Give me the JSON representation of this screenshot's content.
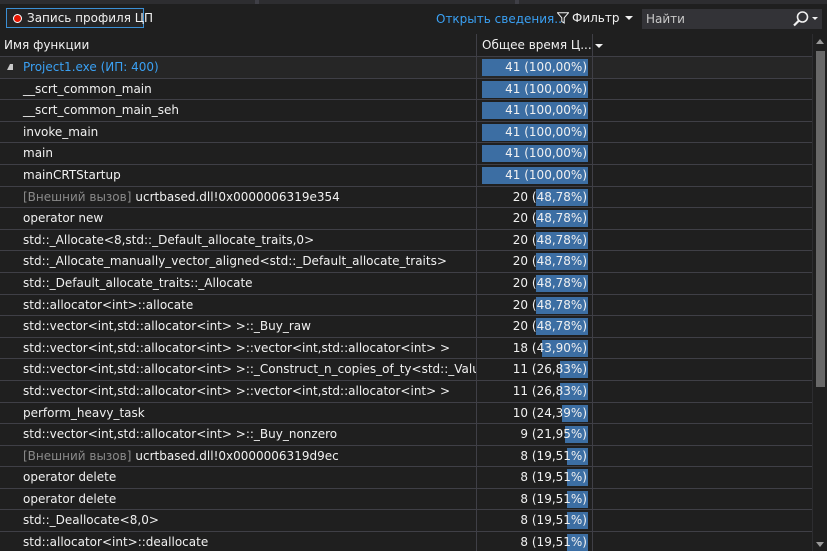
{
  "toolbar": {
    "record_label": "Запись профиля ЦП",
    "open_details_label": "Открыть сведения...",
    "filter_label": "Фильтр",
    "search_placeholder": "Найти"
  },
  "columns": {
    "name": "Имя функции",
    "total_time": "Общее время Ц..."
  },
  "colors": {
    "accent_link": "#3aa0f3",
    "bar": "#3c6ea3",
    "record_dot": "#e51400",
    "background": "#1f1f1f"
  },
  "rows": [
    {
      "name": "Project1.exe (ИП: 400)",
      "prefix": "",
      "time": "41 (100,00%)",
      "percent": 100.0,
      "root": true
    },
    {
      "name": "__scrt_common_main",
      "prefix": "",
      "time": "41 (100,00%)",
      "percent": 100.0
    },
    {
      "name": "__scrt_common_main_seh",
      "prefix": "",
      "time": "41 (100,00%)",
      "percent": 100.0
    },
    {
      "name": "invoke_main",
      "prefix": "",
      "time": "41 (100,00%)",
      "percent": 100.0
    },
    {
      "name": "main",
      "prefix": "",
      "time": "41 (100,00%)",
      "percent": 100.0
    },
    {
      "name": "mainCRTStartup",
      "prefix": "",
      "time": "41 (100,00%)",
      "percent": 100.0
    },
    {
      "name": "ucrtbased.dll!0x0000006319e354",
      "prefix": "[Внешний вызов]",
      "time": "20 (48,78%)",
      "percent": 48.78
    },
    {
      "name": "operator new",
      "prefix": "",
      "time": "20 (48,78%)",
      "percent": 48.78
    },
    {
      "name": "std::_Allocate<8,std::_Default_allocate_traits,0>",
      "prefix": "",
      "time": "20 (48,78%)",
      "percent": 48.78
    },
    {
      "name": "std::_Allocate_manually_vector_aligned<std::_Default_allocate_traits>",
      "prefix": "",
      "time": "20 (48,78%)",
      "percent": 48.78
    },
    {
      "name": "std::_Default_allocate_traits::_Allocate",
      "prefix": "",
      "time": "20 (48,78%)",
      "percent": 48.78
    },
    {
      "name": "std::allocator<int>::allocate",
      "prefix": "",
      "time": "20 (48,78%)",
      "percent": 48.78
    },
    {
      "name": "std::vector<int,std::allocator<int> >::_Buy_raw",
      "prefix": "",
      "time": "20 (48,78%)",
      "percent": 48.78
    },
    {
      "name": "std::vector<int,std::allocator<int> >::vector<int,std::allocator<int> >",
      "prefix": "",
      "time": "18 (43,90%)",
      "percent": 43.9
    },
    {
      "name": "std::vector<int,std::allocator<int> >::_Construct_n_copies_of_ty<std::_Value_init_tag>",
      "prefix": "",
      "time": "11 (26,83%)",
      "percent": 26.83
    },
    {
      "name": "std::vector<int,std::allocator<int> >::vector<int,std::allocator<int> >",
      "prefix": "",
      "time": "11 (26,83%)",
      "percent": 26.83
    },
    {
      "name": "perform_heavy_task",
      "prefix": "",
      "time": "10 (24,39%)",
      "percent": 24.39
    },
    {
      "name": "std::vector<int,std::allocator<int> >::_Buy_nonzero",
      "prefix": "",
      "time": "9 (21,95%)",
      "percent": 21.95
    },
    {
      "name": "ucrtbased.dll!0x0000006319d9ec",
      "prefix": "[Внешний вызов]",
      "time": "8 (19,51%)",
      "percent": 19.51
    },
    {
      "name": "operator delete",
      "prefix": "",
      "time": "8 (19,51%)",
      "percent": 19.51
    },
    {
      "name": "operator delete",
      "prefix": "",
      "time": "8 (19,51%)",
      "percent": 19.51
    },
    {
      "name": "std::_Deallocate<8,0>",
      "prefix": "",
      "time": "8 (19,51%)",
      "percent": 19.51
    },
    {
      "name": "std::allocator<int>::deallocate",
      "prefix": "",
      "time": "8 (19,51%)",
      "percent": 19.51
    }
  ]
}
